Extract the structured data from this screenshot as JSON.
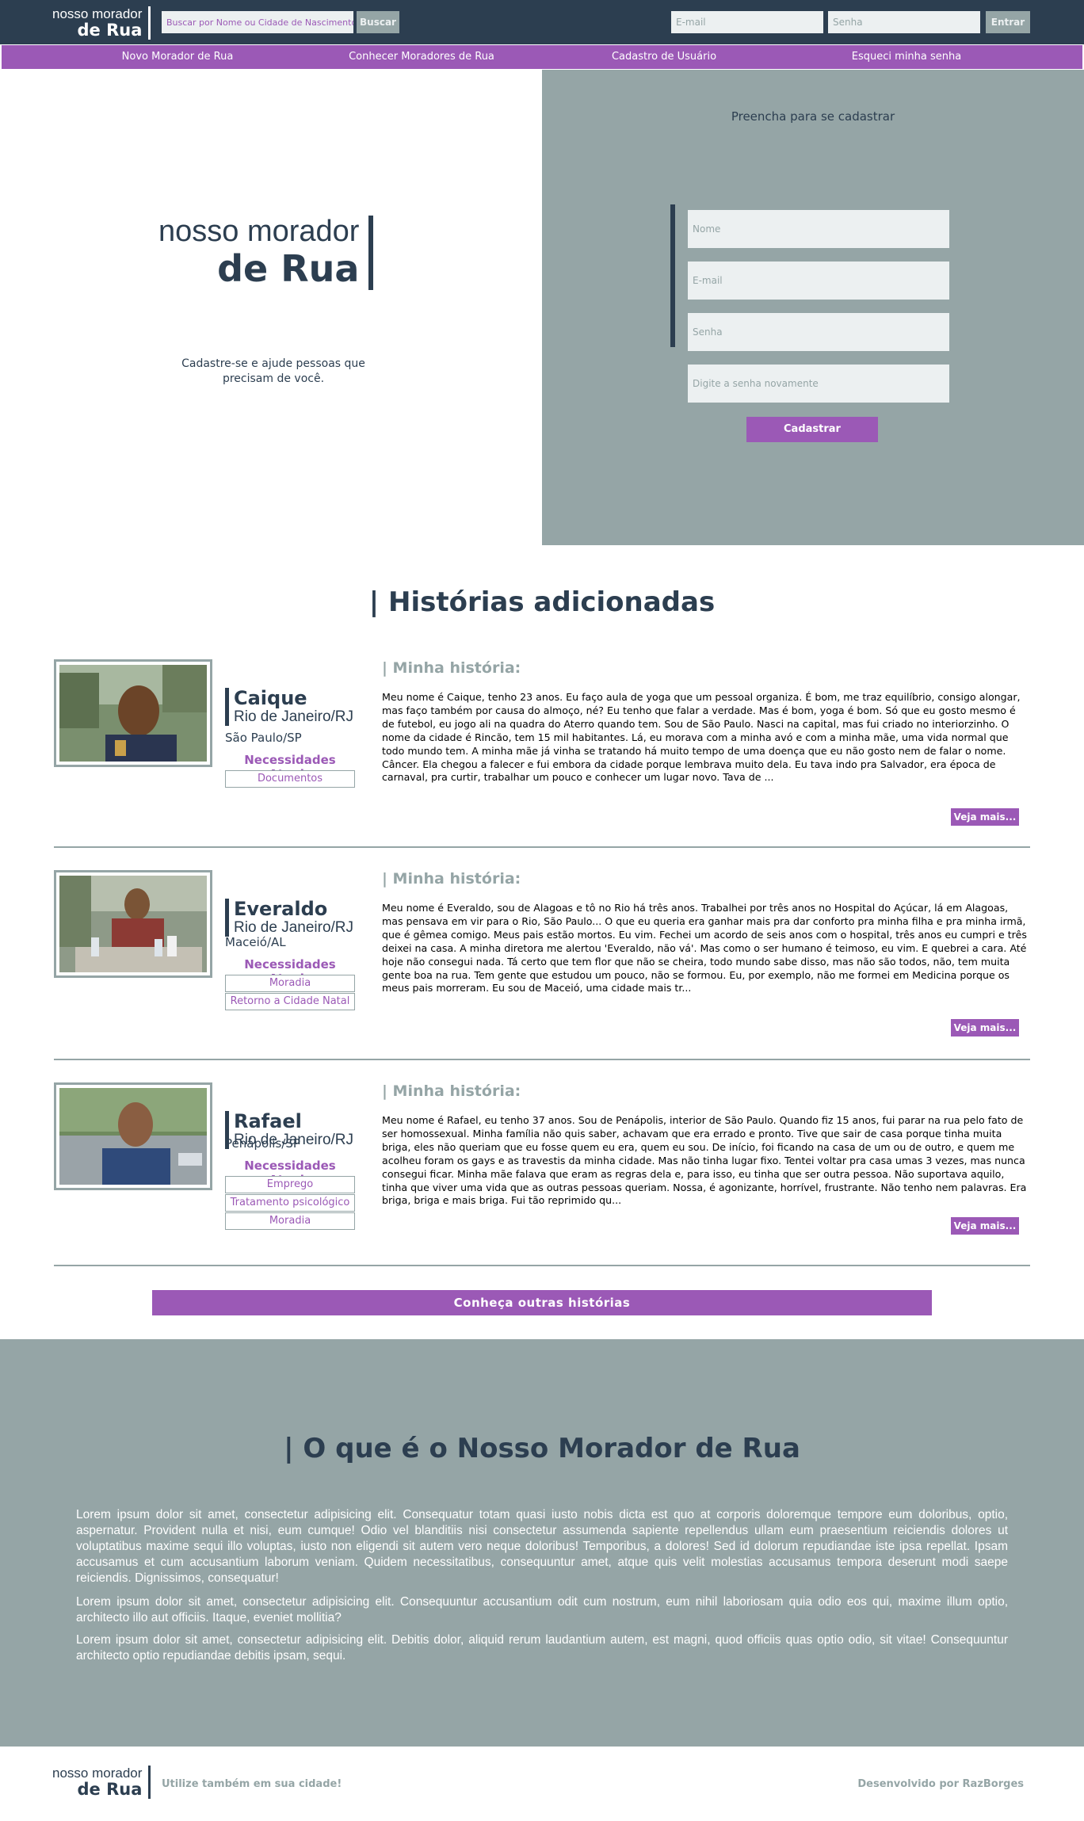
{
  "header": {
    "logo_line1": "nosso morador",
    "logo_line2": "de Rua",
    "search_placeholder": "Buscar por Nome ou Cidade de Nascimento",
    "search_button": "Buscar",
    "email_placeholder": "E-mail",
    "password_placeholder": "Senha",
    "login_button": "Entrar"
  },
  "nav": {
    "items": [
      "Novo Morador de Rua",
      "Conhecer Moradores de Rua",
      "Cadastro de Usuário",
      "Esqueci minha senha"
    ]
  },
  "hero": {
    "logo_line1": "nosso morador",
    "logo_line2": "de Rua",
    "tagline": "Cadastre-se e ajude pessoas que precisam de você."
  },
  "register": {
    "title": "Preencha para se cadastrar",
    "name_placeholder": "Nome",
    "email_placeholder": "E-mail",
    "password_placeholder": "Senha",
    "confirm_placeholder": "Digite a senha novamente",
    "submit": "Cadastrar"
  },
  "stories": {
    "title": "| Histórias adicionadas",
    "story_heading": "| Minha história:",
    "needs_heading": "Necessidades Atuais",
    "more_label": "Veja mais...",
    "items": [
      {
        "name": "Caique",
        "origin": "Rio de Janeiro/RJ",
        "current": "São Paulo/SP",
        "needs": [
          "Documentos"
        ],
        "text": "Meu nome é Caique, tenho 23 anos. Eu faço aula de yoga que um pessoal organiza. É bom, me traz equilíbrio, consigo alongar, mas faço também por causa do almoço, né? Eu tenho que falar a verdade. Mas é bom, yoga é bom. Só que eu gosto mesmo é de futebol, eu jogo ali na quadra do Aterro quando tem. Sou de São Paulo. Nasci na capital, mas fui criado no interiorzinho. O nome da cidade é Rincão, tem 15 mil habitantes. Lá, eu morava com a minha avó e com a minha mãe, uma vida normal que todo mundo tem. A minha mãe já vinha se tratando há muito tempo de uma doença que eu não gosto nem de falar o nome. Câncer. Ela chegou a falecer e fui embora da cidade porque lembrava muito dela. Eu tava indo pra Salvador, era época de carnaval, pra curtir, trabalhar um pouco e conhecer um lugar novo. Tava de ..."
      },
      {
        "name": "Everaldo",
        "origin": "Rio de Janeiro/RJ",
        "current": "Maceió/AL",
        "needs": [
          "Moradia",
          "Retorno a Cidade Natal"
        ],
        "text": "Meu nome é Everaldo, sou de Alagoas e tô no Rio há três anos. Trabalhei por três anos no Hospital do Açúcar, lá em Alagoas, mas pensava em vir para o Rio, São Paulo... O que eu queria era ganhar mais pra dar conforto pra minha filha e pra minha irmã, que é gêmea comigo. Meus pais estão mortos. Eu vim. Fechei um acordo de seis anos com o hospital, três anos eu cumpri e três deixei na casa. A minha diretora me alertou 'Everaldo, não vá'. Mas como o ser humano é teimoso, eu vim. E quebrei a cara. Até hoje não consegui nada. Tá certo que tem flor que não se cheira, todo mundo sabe disso, mas não são todos, não, tem muita gente boa na rua. Tem gente que estudou um pouco, não se formou. Eu, por exemplo, não me formei em Medicina porque os meus pais morreram. Eu sou de Maceió, uma cidade mais tr..."
      },
      {
        "name": "Rafael",
        "origin": "Rio de Janeiro/RJ",
        "current": "Penápolis/SP",
        "needs": [
          "Emprego",
          "Tratamento psicológico",
          "Moradia"
        ],
        "text": "Meu nome é Rafael, eu tenho 37 anos. Sou de Penápolis, interior de São Paulo. Quando fiz 15 anos, fui parar na rua pelo fato de ser homossexual. Minha família não quis saber, achavam que era errado e pronto. Tive que sair de casa porque tinha muita briga, eles não queriam que eu fosse quem eu era, quem eu sou. De início, foi ficando na casa de um ou de outro, e quem me acolheu foram os gays e as travestis da minha cidade. Mas não tinha lugar fixo. Tentei voltar pra casa umas 3 vezes, mas nunca consegui ficar. Minha mãe falava que eram as regras dela e, para isso, eu tinha que ser outra pessoa. Não suportava aquilo, tinha que viver uma vida que as outras pessoas queriam. Nossa, é agonizante, horrível, frustrante. Não tenho nem palavras. Era briga, briga e mais briga. Fui tão reprimido qu..."
      }
    ],
    "more_stories_button": "Conheça outras histórias"
  },
  "about": {
    "title": "| O que é o Nosso Morador de Rua",
    "paragraphs": [
      "Lorem ipsum dolor sit amet, consectetur adipisicing elit. Consequatur totam quasi iusto nobis dicta est quo at corporis doloremque tempore eum doloribus, optio, aspernatur. Provident nulla et nisi, eum cumque! Odio vel blanditiis nisi consectetur assumenda sapiente repellendus ullam eum praesentium reiciendis dolores ut voluptatibus maxime sequi illo voluptas, iusto non eligendi sit autem vero neque doloribus! Temporibus, a dolores! Sed id dolorum repudiandae iste ipsa repellat. Ipsam accusamus et cum accusantium laborum veniam. Quidem necessitatibus, consequuntur amet, atque quis velit molestias accusamus tempora deserunt modi saepe reiciendis. Dignissimos, consequatur!",
      "Lorem ipsum dolor sit amet, consectetur adipisicing elit. Consequuntur accusantium odit cum nostrum, eum nihil laboriosam quia odio eos qui, maxime illum optio, architecto illo aut officiis. Itaque, eveniet mollitia?",
      "Lorem ipsum dolor sit amet, consectetur adipisicing elit. Debitis dolor, aliquid rerum laudantium autem, est magni, quod officiis quas optio odio, sit vitae! Consequuntur architecto optio repudiandae debitis ipsam, sequi."
    ]
  },
  "footer": {
    "logo_line1": "nosso morador",
    "logo_line2": "de Rua",
    "tagline": "Utilize também em sua cidade!",
    "credit": "Desenvolvido por RazBorges"
  },
  "colors": {
    "primary_dark": "#2c3e50",
    "accent_purple": "#9b59b6",
    "grey": "#95a5a6",
    "light": "#ecf0f1"
  }
}
